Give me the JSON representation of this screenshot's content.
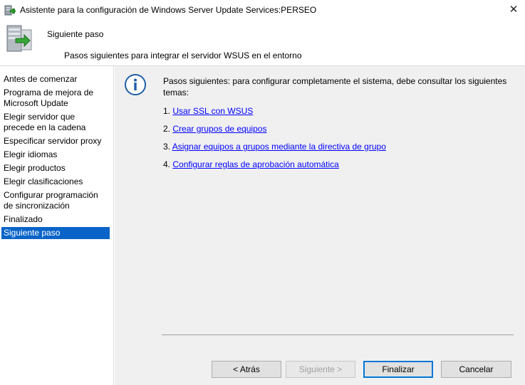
{
  "window": {
    "title": "Asistente para la configuración de Windows Server Update Services:PERSEO",
    "close_glyph": "✕"
  },
  "header": {
    "title": "Siguiente paso",
    "subtitle": "Pasos siguientes para integrar el servidor WSUS en el entorno"
  },
  "nav": {
    "items": [
      {
        "label": "Antes de comenzar",
        "active": false
      },
      {
        "label": "Programa de mejora de Microsoft Update",
        "active": false
      },
      {
        "label": "Elegir servidor que precede en la cadena",
        "active": false
      },
      {
        "label": "Especificar servidor proxy",
        "active": false
      },
      {
        "label": "Elegir idiomas",
        "active": false
      },
      {
        "label": "Elegir productos",
        "active": false
      },
      {
        "label": "Elegir clasificaciones",
        "active": false
      },
      {
        "label": "Configurar programación de sincronización",
        "active": false
      },
      {
        "label": "Finalizado",
        "active": false
      },
      {
        "label": "Siguiente paso",
        "active": true
      }
    ]
  },
  "content": {
    "intro": "Pasos siguientes: para configurar completamente el sistema, debe consultar los siguientes temas:",
    "steps": [
      {
        "num": "1.",
        "link": "Usar SSL con WSUS"
      },
      {
        "num": "2.",
        "link": "Crear grupos de equipos"
      },
      {
        "num": "3.",
        "link": "Asignar equipos a grupos mediante la directiva de grupo"
      },
      {
        "num": "4.",
        "link": "Configurar reglas de aprobación automática"
      }
    ]
  },
  "buttons": {
    "back": "< Atrás",
    "next": "Siguiente >",
    "finish": "Finalizar",
    "cancel": "Cancelar"
  },
  "colors": {
    "nav_active_bg": "#0a64c8",
    "link": "#0000ff",
    "content_bg": "#f0f0f0"
  }
}
